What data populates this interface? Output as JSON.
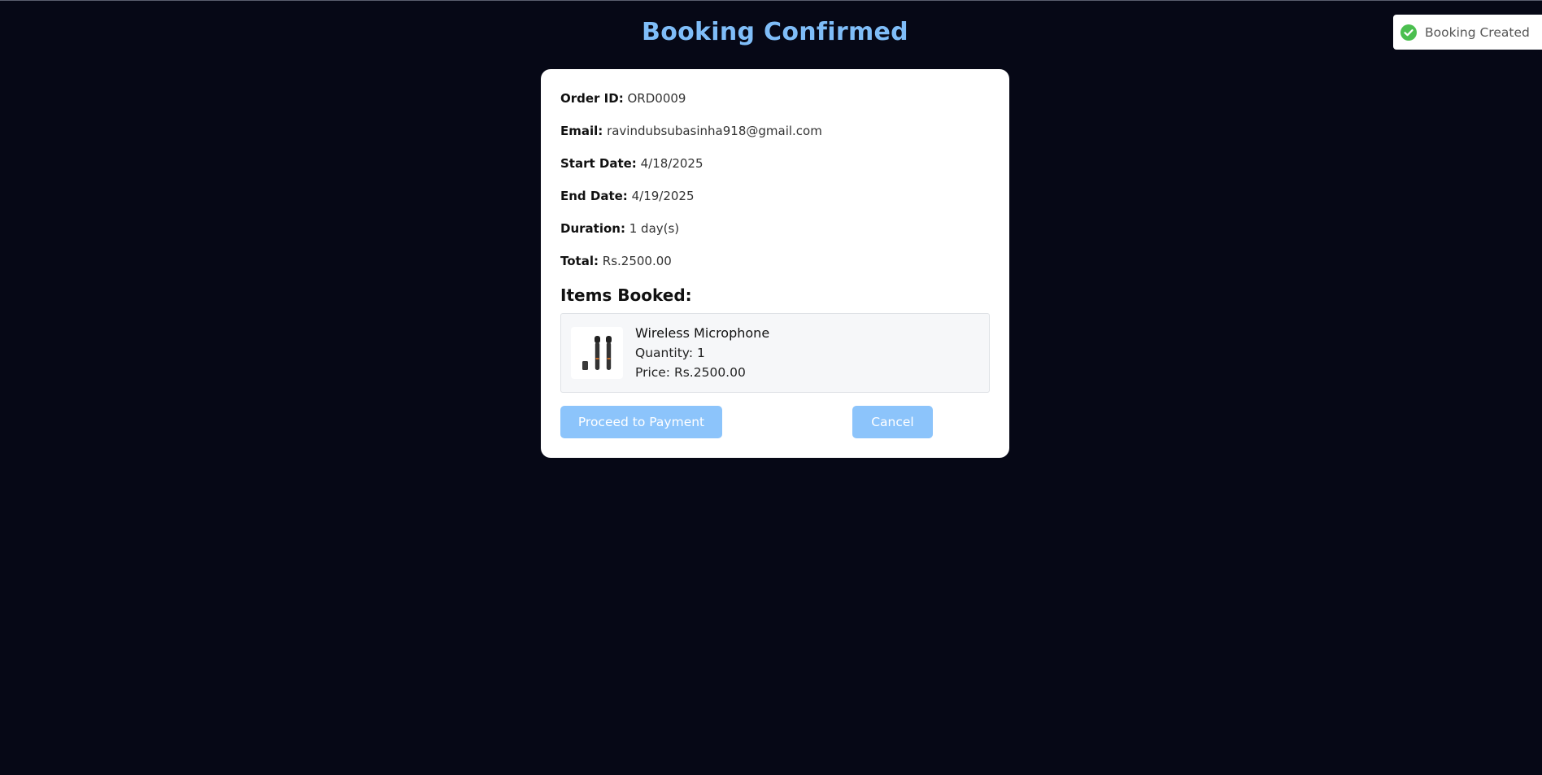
{
  "page": {
    "title": "Booking Confirmed"
  },
  "details": [
    {
      "label": "Order ID:",
      "value": "ORD0009"
    },
    {
      "label": "Email:",
      "value": "ravindubsubasinha918@gmail.com"
    },
    {
      "label": "Start Date:",
      "value": "4/18/2025"
    },
    {
      "label": "End Date:",
      "value": "4/19/2025"
    },
    {
      "label": "Duration:",
      "value": "1 day(s)"
    },
    {
      "label": "Total:",
      "value": "Rs.2500.00"
    }
  ],
  "items": {
    "heading": "Items Booked:",
    "list": [
      {
        "name": "Wireless Microphone",
        "quantity": "Quantity: 1",
        "price": "Price: Rs.2500.00",
        "image_icon": "microphone-product-image"
      }
    ]
  },
  "actions": {
    "pay_label": "Proceed to Payment",
    "cancel_label": "Cancel"
  },
  "toast": {
    "text": "Booking Created",
    "icon": "check-circle-icon"
  },
  "colors": {
    "background": "#060816",
    "title": "#7fbdf8",
    "button": "#8cc4fb",
    "success": "#4bbf4f"
  }
}
